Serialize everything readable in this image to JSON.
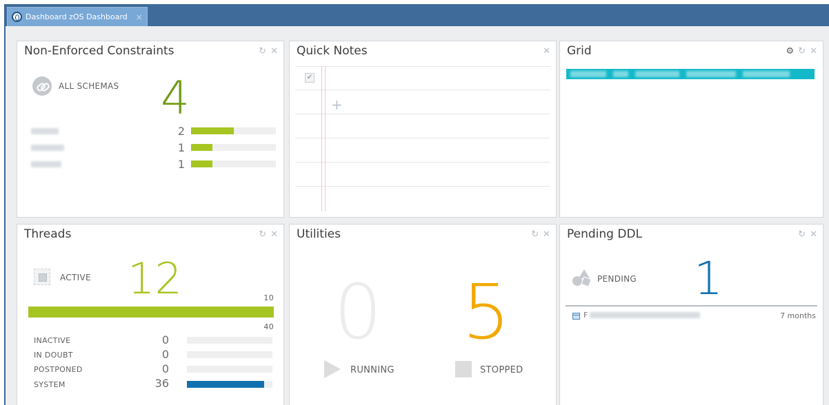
{
  "window": {
    "tab_label": "Dashboard zOS Dashboard",
    "tab_close": "×"
  },
  "colors": {
    "header_blue": "#3e6b99",
    "accent_green": "#a7c522",
    "big_green": "#6f9a12",
    "active_green": "#a7c522",
    "orange": "#f2a900",
    "blue_number": "#1171b0",
    "system_bar": "#1171b0",
    "grid_header": "#13b9c9"
  },
  "icons": {
    "refresh": "↻",
    "close": "✕",
    "gear": "⚙",
    "check": "✔",
    "plus": "+"
  },
  "non_enforced": {
    "title": "Non-Enforced Constraints",
    "scope_label": "ALL SCHEMAS",
    "total": "4",
    "rows": [
      {
        "value": "2",
        "fraction": 0.5
      },
      {
        "value": "1",
        "fraction": 0.25
      },
      {
        "value": "1",
        "fraction": 0.25
      }
    ]
  },
  "quick_notes": {
    "title": "Quick Notes"
  },
  "grid": {
    "title": "Grid"
  },
  "threads": {
    "title": "Threads",
    "active_label": "ACTIVE",
    "active_value": "12",
    "bar_top_label": "10",
    "bar_bottom_label": "40",
    "active_fraction": 1.0,
    "rows": [
      {
        "label": "INACTIVE",
        "value": "0",
        "fraction": 0
      },
      {
        "label": "IN DOUBT",
        "value": "0",
        "fraction": 0
      },
      {
        "label": "POSTPONED",
        "value": "0",
        "fraction": 0
      },
      {
        "label": "SYSTEM",
        "value": "36",
        "fraction": 0.9
      }
    ]
  },
  "utilities": {
    "title": "Utilities",
    "running_value": "0",
    "running_label": "RUNNING",
    "stopped_value": "5",
    "stopped_label": "STOPPED"
  },
  "pending_ddl": {
    "title": "Pending DDL",
    "pending_label": "PENDING",
    "pending_value": "1",
    "item_prefix": "F",
    "item_age": "7 months"
  }
}
